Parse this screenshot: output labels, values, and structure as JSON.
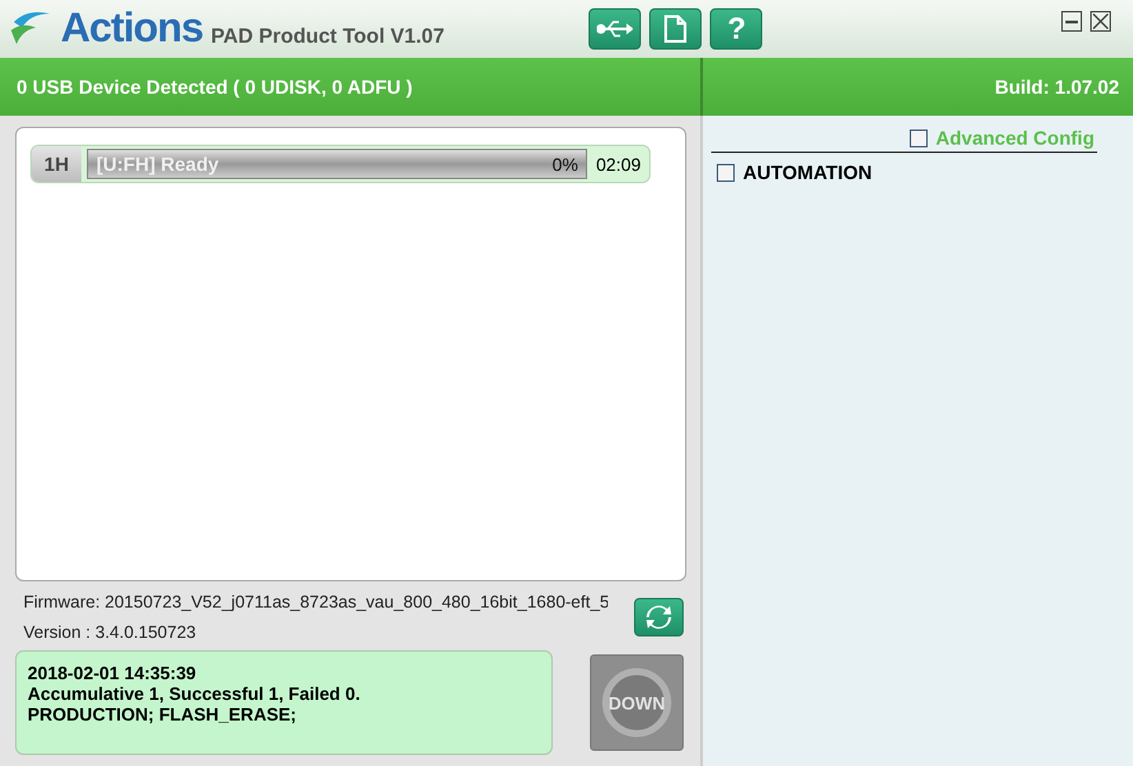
{
  "window": {
    "brand": "Actions",
    "title": "PAD Product Tool V1.07"
  },
  "toolbar": [
    {
      "kind": "usb"
    },
    {
      "kind": "file"
    },
    {
      "kind": "help",
      "label": "?"
    }
  ],
  "status": {
    "devices": "0 USB Device Detected ( 0 UDISK, 0 ADFU )",
    "build": "Build: 1.07.02"
  },
  "ports": [
    {
      "id": "1H",
      "status": "[U:FH] Ready",
      "percent": "0%",
      "level": 0,
      "time": "02:09"
    }
  ],
  "firmware": {
    "name": "Firmware: 20150723_V52_j0711as_8723as_vau_800_480_16bit_1680-eft_5",
    "version": "Version : 3.4.0.150723"
  },
  "log": [
    "2018-02-01 14:35:39",
    "Accumulative 1, Successful 1, Failed 0.",
    "PRODUCTION; FLASH_ERASE;"
  ],
  "down_button": {
    "label": "DOWN",
    "disabled": true
  },
  "options": [
    {
      "label": "Advanced Config",
      "checked": false,
      "kind": "link"
    },
    {
      "label": "AUTOMATION",
      "checked": false,
      "kind": "plain"
    }
  ]
}
